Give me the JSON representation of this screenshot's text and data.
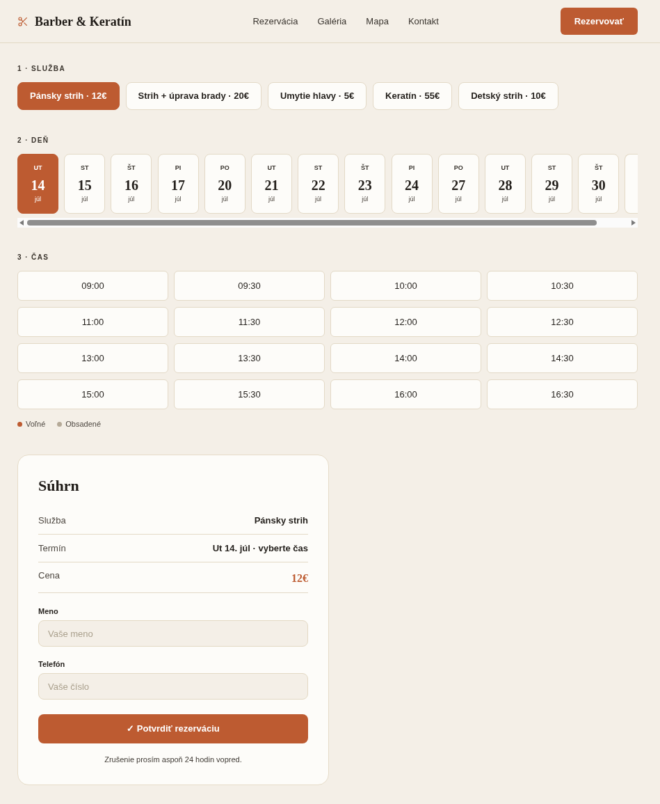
{
  "header": {
    "logo": "Barber & Keratín",
    "nav": [
      {
        "label": "Rezervácia"
      },
      {
        "label": "Galéria"
      },
      {
        "label": "Mapa"
      },
      {
        "label": "Kontakt"
      }
    ],
    "cta": "Rezervovať"
  },
  "service_section": {
    "heading": "1 · SLUŽBA",
    "services": [
      {
        "label": "Pánsky strih · 12€",
        "selected": true
      },
      {
        "label": "Strih + úprava brady · 20€",
        "selected": false
      },
      {
        "label": "Umytie hlavy · 5€",
        "selected": false
      },
      {
        "label": "Keratín · 55€",
        "selected": false
      },
      {
        "label": "Detský strih · 10€",
        "selected": false
      }
    ]
  },
  "day_section": {
    "heading": "2 · DEŇ",
    "days": [
      {
        "weekday": "UT",
        "day": "14",
        "month": "júl",
        "selected": true
      },
      {
        "weekday": "ST",
        "day": "15",
        "month": "júl",
        "selected": false
      },
      {
        "weekday": "ŠT",
        "day": "16",
        "month": "júl",
        "selected": false
      },
      {
        "weekday": "PI",
        "day": "17",
        "month": "júl",
        "selected": false
      },
      {
        "weekday": "PO",
        "day": "20",
        "month": "júl",
        "selected": false
      },
      {
        "weekday": "UT",
        "day": "21",
        "month": "júl",
        "selected": false
      },
      {
        "weekday": "ST",
        "day": "22",
        "month": "júl",
        "selected": false
      },
      {
        "weekday": "ŠT",
        "day": "23",
        "month": "júl",
        "selected": false
      },
      {
        "weekday": "PI",
        "day": "24",
        "month": "júl",
        "selected": false
      },
      {
        "weekday": "PO",
        "day": "27",
        "month": "júl",
        "selected": false
      },
      {
        "weekday": "UT",
        "day": "28",
        "month": "júl",
        "selected": false
      },
      {
        "weekday": "ST",
        "day": "29",
        "month": "júl",
        "selected": false
      },
      {
        "weekday": "ŠT",
        "day": "30",
        "month": "júl",
        "selected": false
      }
    ]
  },
  "time_section": {
    "heading": "3 · ČAS",
    "slots": [
      {
        "time": "09:00",
        "selected": false
      },
      {
        "time": "09:30",
        "selected": false
      },
      {
        "time": "10:00",
        "selected": false
      },
      {
        "time": "10:30",
        "selected": false
      },
      {
        "time": "11:00",
        "selected": false
      },
      {
        "time": "11:30",
        "selected": false
      },
      {
        "time": "12:00",
        "selected": false
      },
      {
        "time": "12:30",
        "selected": false
      },
      {
        "time": "13:00",
        "selected": false
      },
      {
        "time": "13:30",
        "selected": false
      },
      {
        "time": "14:00",
        "selected": false
      },
      {
        "time": "14:30",
        "selected": false
      },
      {
        "time": "15:00",
        "selected": false
      },
      {
        "time": "15:30",
        "selected": false
      },
      {
        "time": "16:00",
        "selected": false
      },
      {
        "time": "16:30",
        "selected": false
      }
    ],
    "legend": [
      {
        "label": "Voľné",
        "color": "#bd5b31"
      },
      {
        "label": "Obsadené",
        "color": "#b5aa98"
      }
    ]
  },
  "summary": {
    "title": "Súhrn",
    "rows": [
      {
        "label": "Služba",
        "value": "Pánsky strih",
        "kind": "text"
      },
      {
        "label": "Termín",
        "value": "Ut 14. júl · vyberte čas",
        "kind": "text"
      },
      {
        "label": "Cena",
        "value": "12€",
        "kind": "price"
      }
    ],
    "fields": [
      {
        "label": "Meno",
        "placeholder": "Vaše meno"
      },
      {
        "label": "Telefón",
        "placeholder": "Vaše číslo"
      }
    ],
    "submit": "✓ Potvrdiť rezerváciu",
    "note": "Zrušenie prosím aspoň 24 hodin vopred."
  }
}
